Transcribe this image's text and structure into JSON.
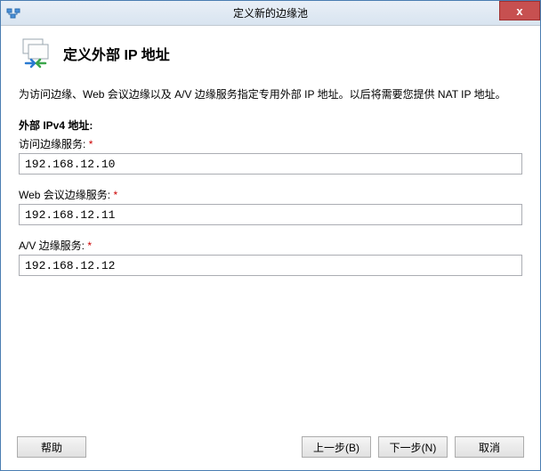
{
  "window": {
    "title": "定义新的边缘池",
    "close_label": "x"
  },
  "header": {
    "heading": "定义外部 IP 地址"
  },
  "description": "为访问边缘、Web 会议边缘以及 A/V 边缘服务指定专用外部 IP 地址。以后将需要您提供 NAT IP 地址。",
  "fields": {
    "section_title": "外部 IPv4 地址:",
    "access": {
      "label": "访问边缘服务:",
      "required_mark": "*",
      "value": "192.168.12.10"
    },
    "webconf": {
      "label": "Web 会议边缘服务:",
      "required_mark": "*",
      "value": "192.168.12.11"
    },
    "av": {
      "label": "A/V 边缘服务:",
      "required_mark": "*",
      "value": "192.168.12.12"
    }
  },
  "footer": {
    "help": "帮助",
    "back": "上一步(B)",
    "next": "下一步(N)",
    "cancel": "取消"
  },
  "colors": {
    "accent": "#4a7db1",
    "close_bg": "#c75050"
  }
}
